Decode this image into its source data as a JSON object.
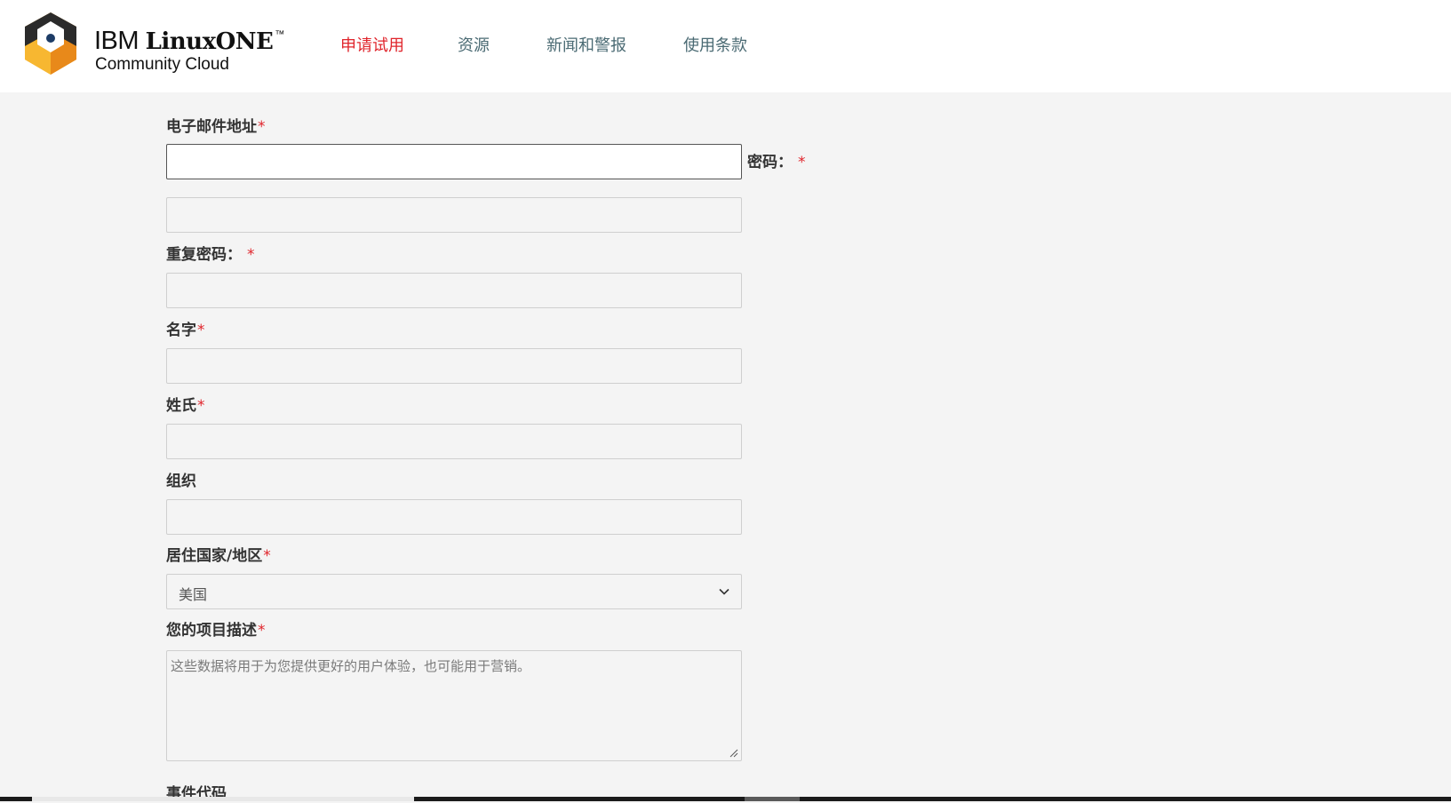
{
  "header": {
    "logo": {
      "brand": "IBM",
      "product": "LinuxONE",
      "trademark": "™",
      "subtitle": "Community Cloud"
    },
    "nav": [
      {
        "label": "申请试用",
        "active": true
      },
      {
        "label": "资源",
        "active": false
      },
      {
        "label": "新闻和警报",
        "active": false
      },
      {
        "label": "使用条款",
        "active": false
      }
    ]
  },
  "form": {
    "required_mark": "*",
    "email": {
      "label": "电子邮件地址",
      "value": ""
    },
    "password": {
      "label": "密码：",
      "value": ""
    },
    "repeat_password": {
      "label": "重复密码：",
      "value": ""
    },
    "first_name": {
      "label": "名字",
      "value": ""
    },
    "last_name": {
      "label": "姓氏",
      "value": ""
    },
    "organization": {
      "label": "组织",
      "value": ""
    },
    "country": {
      "label": "居住国家/地区",
      "selected": "美国"
    },
    "project_description": {
      "label": "您的项目描述",
      "placeholder": "这些数据将用于为您提供更好的用户体验，也可能用于营销。"
    },
    "event_code": {
      "label": "事件代码"
    }
  },
  "colors": {
    "accent_red": "#e0242b",
    "nav_text": "#4a6a73",
    "page_bg": "#f4f4f4",
    "header_bg": "#ffffff"
  },
  "icons": [
    "linuxone-logo-icon",
    "chevron-down-icon",
    "resize-grip-icon"
  ]
}
